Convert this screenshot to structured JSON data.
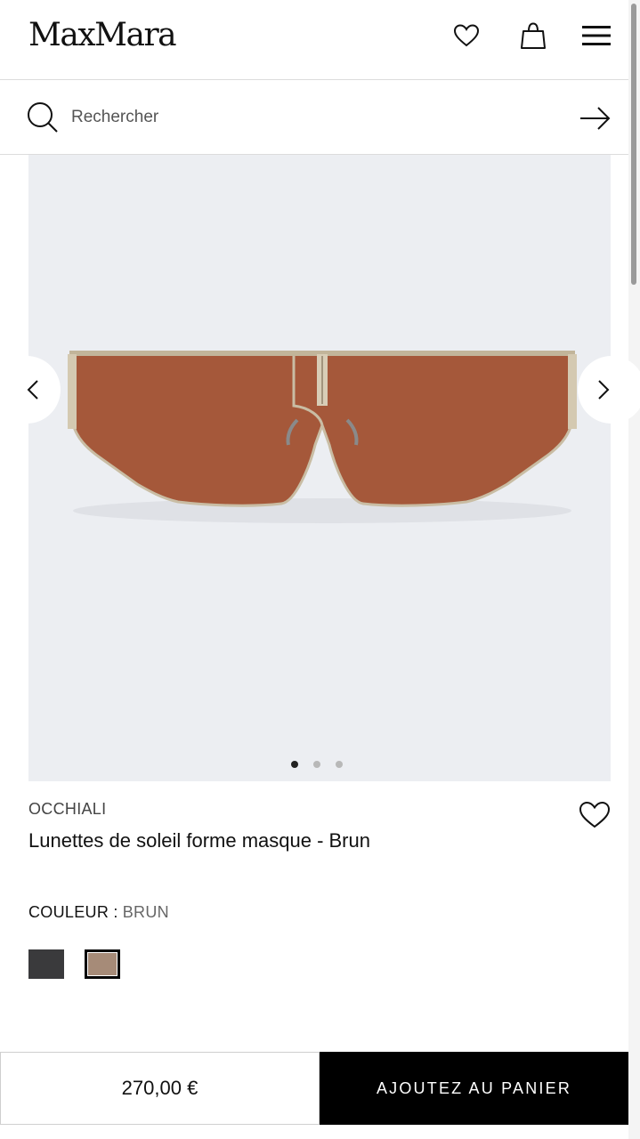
{
  "header": {
    "logo": "MaxMara"
  },
  "search": {
    "placeholder": "Rechercher"
  },
  "gallery": {
    "image_count": 3,
    "active_index": 0
  },
  "product": {
    "category": "OCCHIALI",
    "title": "Lunettes de soleil forme masque - Brun",
    "color_label": "COULEUR :",
    "color_value": "BRUN",
    "swatches": [
      {
        "name": "black",
        "color": "#3a3a3c",
        "selected": false
      },
      {
        "name": "brown",
        "color": "#a68b78",
        "selected": true
      }
    ],
    "lens_color": "#a5583a"
  },
  "cart": {
    "price": "270,00 €",
    "add_label": "AJOUTEZ AU PANIER"
  }
}
